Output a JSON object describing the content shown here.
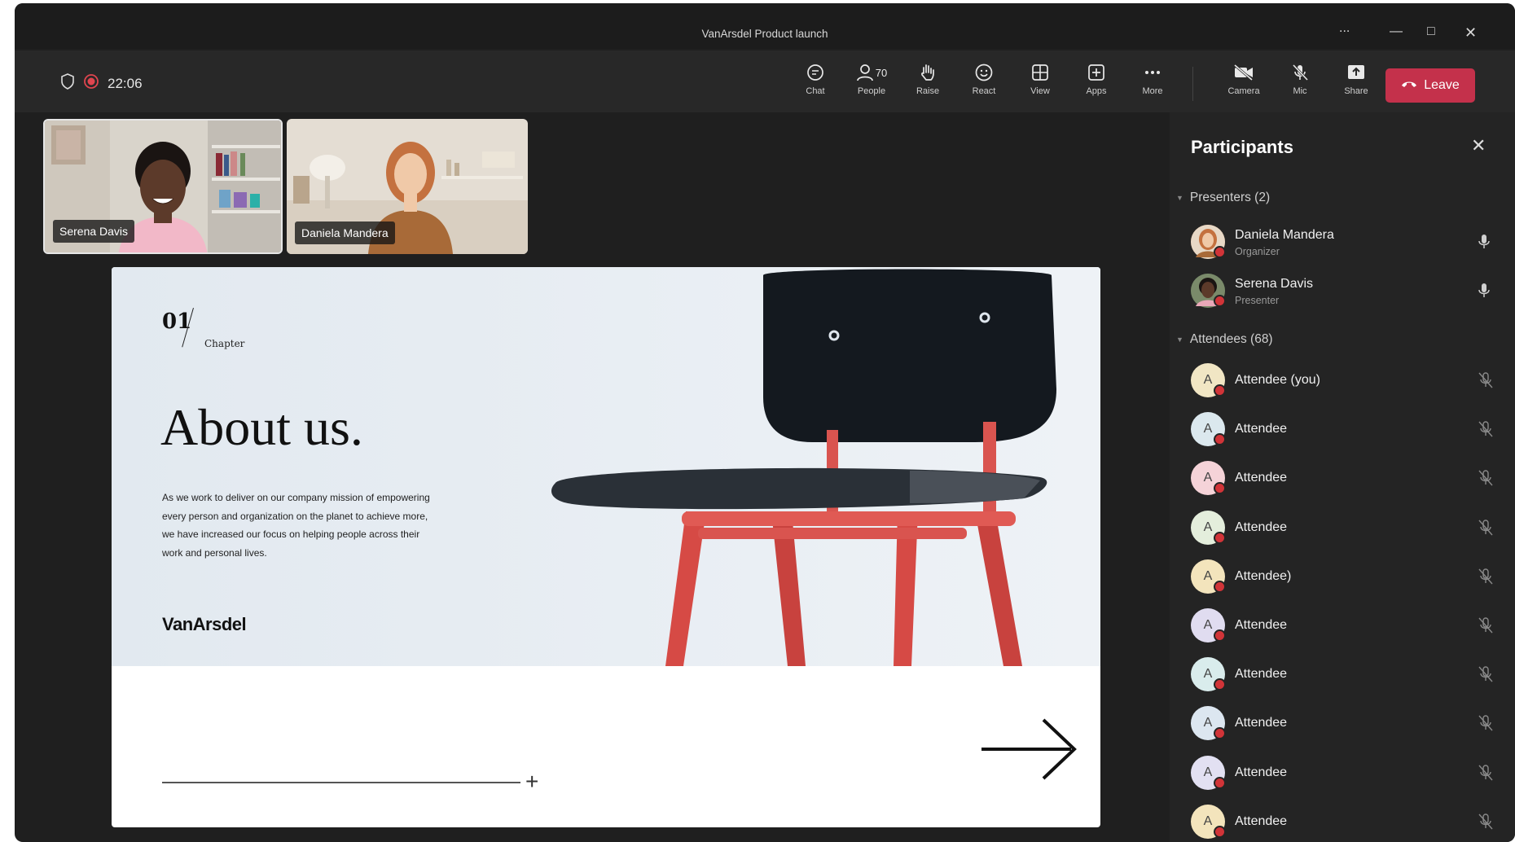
{
  "window": {
    "title": "VanArsdel Product launch",
    "controls": [
      "...",
      "—",
      "□",
      "✕"
    ]
  },
  "toolbar": {
    "timer": "22:06",
    "buttons": [
      {
        "label": "Chat",
        "icon": "chat-icon"
      },
      {
        "label": "People",
        "icon": "people-icon",
        "count": "70"
      },
      {
        "label": "Raise",
        "icon": "raise-hand-icon"
      },
      {
        "label": "React",
        "icon": "react-smiley-icon"
      },
      {
        "label": "View",
        "icon": "view-grid-icon"
      },
      {
        "label": "Apps",
        "icon": "apps-plus-icon"
      },
      {
        "label": "More",
        "icon": "more-dots-icon"
      },
      {
        "label": "Camera",
        "icon": "camera-off-icon"
      },
      {
        "label": "Mic",
        "icon": "mic-off-icon"
      },
      {
        "label": "Share",
        "icon": "share-icon"
      }
    ],
    "leave_label": "Leave"
  },
  "video_tiles": [
    {
      "name": "Serena Davis"
    },
    {
      "name": "Daniela Mandera"
    }
  ],
  "slide": {
    "chapter_number": "01",
    "chapter_label": "Chapter",
    "heading": "About us.",
    "body": "As we work to deliver on our company mission of empowering every person and organization on the planet to achieve more, we have increased our focus on helping people across their work and personal lives.",
    "brand": "VanArsdel"
  },
  "participants": {
    "title": "Participants",
    "presenters_header": "Presenters (2)",
    "presenters": [
      {
        "name": "Daniela Mandera",
        "role": "Organizer"
      },
      {
        "name": "Serena Davis",
        "role": "Presenter"
      }
    ],
    "attendees_header": "Attendees (68)",
    "attendees": [
      {
        "initial": "A",
        "name": "Attendee (you)",
        "color": "#f1e6c4"
      },
      {
        "initial": "A",
        "name": "Attendee",
        "color": "#dbe8ee"
      },
      {
        "initial": "A",
        "name": "Attendee",
        "color": "#f5d3d8"
      },
      {
        "initial": "A",
        "name": "Attendee",
        "color": "#e4eedc"
      },
      {
        "initial": "A",
        "name": "Attendee)",
        "color": "#f3e4bc"
      },
      {
        "initial": "A",
        "name": "Attendee",
        "color": "#e0dcf0"
      },
      {
        "initial": "A",
        "name": "Attendee",
        "color": "#d9ecec"
      },
      {
        "initial": "A",
        "name": "Attendee",
        "color": "#dce6f0"
      },
      {
        "initial": "A",
        "name": "Attendee",
        "color": "#e2e0f2"
      },
      {
        "initial": "A",
        "name": "Attendee",
        "color": "#f3e4bc"
      }
    ]
  },
  "colors": {
    "leave": "#c4314b",
    "status_dot": "#d13438",
    "panel_bg": "#242424",
    "window_bg": "#1f1f1f"
  }
}
